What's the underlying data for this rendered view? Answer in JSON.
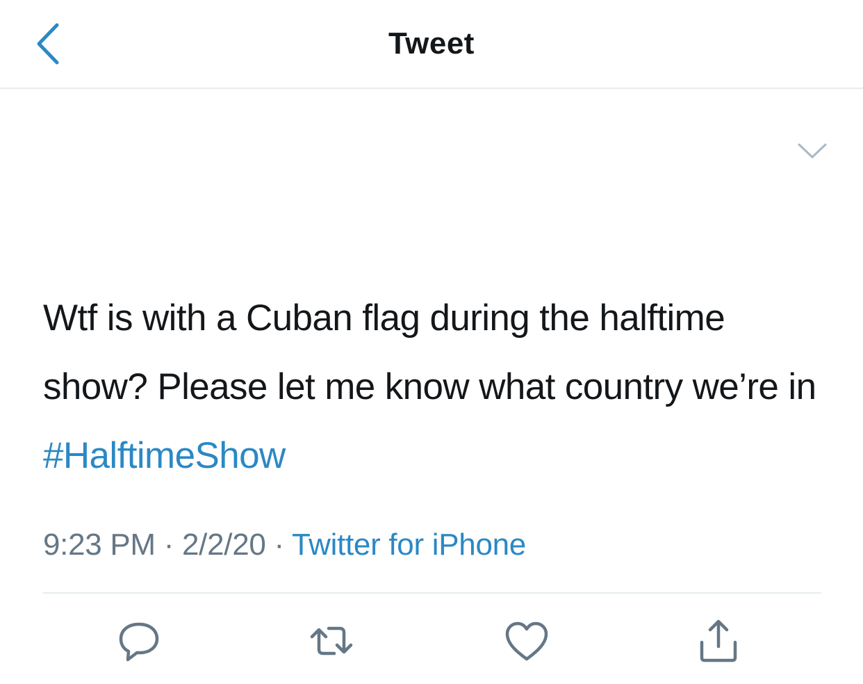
{
  "header": {
    "title": "Tweet",
    "back_icon": "chevron-left-icon"
  },
  "tweet": {
    "text_parts": [
      "Wtf is with a Cuban flag during the halftime show? Please let me know what country we’re in ",
      "#HalftimeShow"
    ],
    "more_icon": "chevron-down-icon",
    "time": "9:23 PM",
    "date": "2/2/20",
    "separator": "·",
    "source": "Twitter for iPhone"
  },
  "actions": [
    {
      "name": "reply",
      "icon": "reply-icon"
    },
    {
      "name": "retweet",
      "icon": "retweet-icon"
    },
    {
      "name": "like",
      "icon": "heart-icon"
    },
    {
      "name": "share",
      "icon": "share-icon"
    }
  ],
  "colors": {
    "accent": "#2b88c5",
    "text": "#14171a",
    "muted": "#657786",
    "divider": "#e6ecf0",
    "icon": "#657786"
  }
}
